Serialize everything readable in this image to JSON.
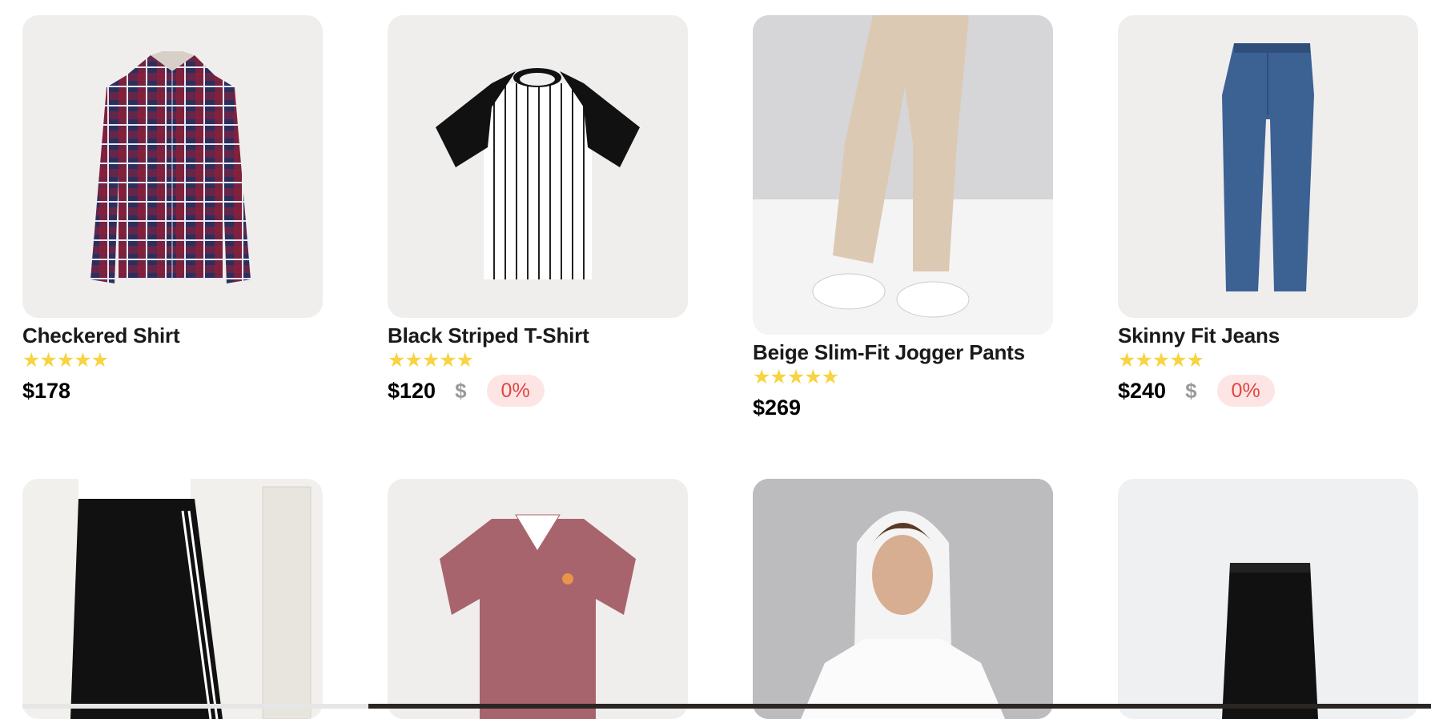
{
  "products_row1": [
    {
      "title": "Checkered Shirt",
      "stars": "★★★★★",
      "price": "$178",
      "old_price": "",
      "discount": ""
    },
    {
      "title": "Black Striped T-Shirt",
      "stars": "★★★★★",
      "price": "$120",
      "old_price": "$",
      "discount": "0%"
    },
    {
      "title": "Beige Slim-Fit Jogger Pants",
      "stars": "★★★★★",
      "price": "$269",
      "old_price": "",
      "discount": ""
    },
    {
      "title": "Skinny Fit Jeans",
      "stars": "★★★★★",
      "price": "$240",
      "old_price": "$",
      "discount": "0%"
    }
  ],
  "products_row2": [
    {
      "image": "black-track-pants"
    },
    {
      "image": "red-polo-shirt"
    },
    {
      "image": "white-hoodie"
    },
    {
      "image": "black-jeans"
    }
  ],
  "colors": {
    "star": "#f7d440",
    "discount_text": "#e2453f",
    "discount_bg": "#fde5e5",
    "card_bg": "#f0eeed"
  }
}
